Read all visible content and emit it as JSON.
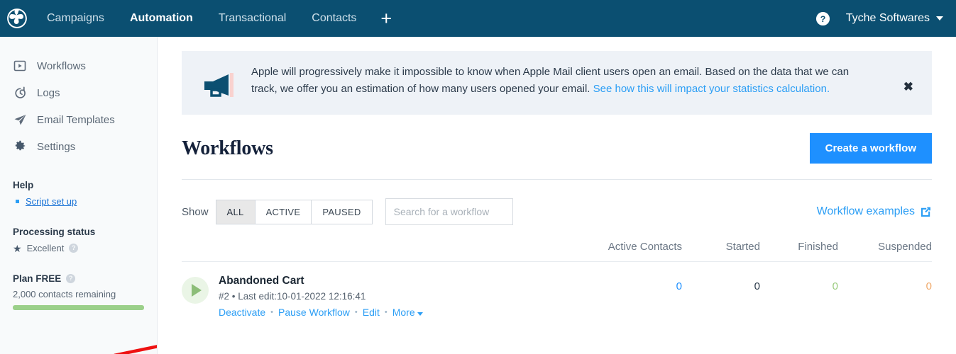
{
  "topnav": {
    "logo_name": "brevo-pinwheel-logo",
    "items": [
      {
        "label": "Campaigns",
        "active": false
      },
      {
        "label": "Automation",
        "active": true
      },
      {
        "label": "Transactional",
        "active": false
      },
      {
        "label": "Contacts",
        "active": false
      }
    ],
    "plus_label": "+",
    "help_icon": "help-circle-icon",
    "account_label": "Tyche Softwares",
    "background": "#0b4f71"
  },
  "sidebar": {
    "items": [
      {
        "label": "Workflows",
        "icon": "play-box-icon"
      },
      {
        "label": "Logs",
        "icon": "history-icon"
      },
      {
        "label": "Email Templates",
        "icon": "paper-plane-icon"
      },
      {
        "label": "Settings",
        "icon": "gear-icon"
      }
    ],
    "help": {
      "heading": "Help",
      "link_label": "Script set up"
    },
    "processing": {
      "heading": "Processing status",
      "status_label": "Excellent",
      "info_glyph": "?"
    },
    "plan": {
      "heading": "Plan FREE",
      "info_glyph": "?",
      "contacts_label": "2,000 contacts remaining",
      "progress_percent": 100
    }
  },
  "banner": {
    "icon": "megaphone-icon",
    "text_part1": "Apple will progressively make it impossible to know when Apple Mail client users open an email. Based on the data that we can track, we offer you an estimation of how many users opened your email. ",
    "link_label": "See how this will impact your statistics calculation.",
    "close_label": "✖",
    "background": "#eef2f7",
    "link_color": "#2b9ef5"
  },
  "page": {
    "title": "Workflows",
    "create_button": "Create a workflow",
    "create_button_color": "#1e90ff"
  },
  "filters": {
    "show_label": "Show",
    "segments": [
      {
        "label": "ALL",
        "active": true
      },
      {
        "label": "ACTIVE",
        "active": false
      },
      {
        "label": "PAUSED",
        "active": false
      }
    ],
    "search_placeholder": "Search for a workflow",
    "search_value": "",
    "examples_label": "Workflow examples",
    "examples_icon": "external-link-icon"
  },
  "table": {
    "columns": [
      "Active Contacts",
      "Started",
      "Finished",
      "Suspended"
    ],
    "rows": [
      {
        "status_icon": "play-icon",
        "name": "Abandoned Cart",
        "meta": "#2 • Last edit:10-01-2022 12:16:41",
        "actions": [
          "Deactivate",
          "Pause Workflow",
          "Edit",
          "More"
        ],
        "active_contacts": "0",
        "started": "0",
        "finished": "0",
        "suspended": "0"
      }
    ],
    "value_colors": {
      "active_contacts": "#1e90ff",
      "started": "#2b3a4a",
      "finished": "#9bcc7f",
      "suspended": "#f0a96a"
    }
  },
  "annotation": {
    "arrow": "red-arrow-pointing-right",
    "color": "#ee1111"
  }
}
